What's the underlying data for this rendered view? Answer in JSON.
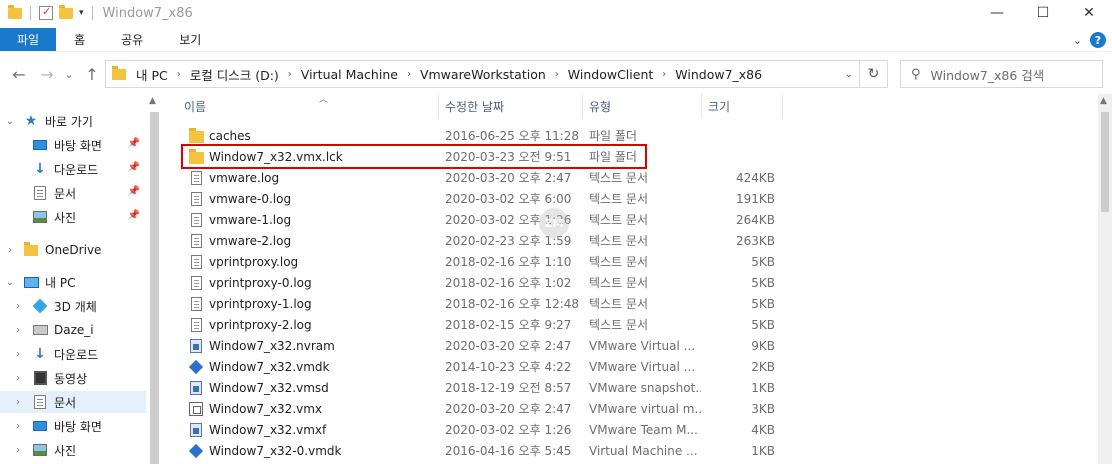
{
  "window": {
    "title": "Window7_x86",
    "controls": {
      "minimize": "—",
      "maximize": "☐",
      "close": "✕"
    }
  },
  "ribbon": {
    "tabs": [
      "파일",
      "홈",
      "공유",
      "보기"
    ],
    "help": "?"
  },
  "nav": {
    "back": "←",
    "forward": "→",
    "recent": "⌄",
    "up": "↑",
    "breadcrumb": [
      "내 PC",
      "로컬 디스크 (D:)",
      "Virtual Machine",
      "VmwareWorkstation",
      "WindowClient",
      "Window7_x86"
    ],
    "refresh": "↻",
    "search_placeholder": "Window7_x86 검색"
  },
  "sidebar": {
    "items": [
      {
        "label": "바로 가기",
        "icon": "star-icon",
        "pinned": false,
        "chevron": "⌄"
      },
      {
        "label": "바탕 화면",
        "icon": "desktop-icon",
        "pinned": true
      },
      {
        "label": "다운로드",
        "icon": "download-icon",
        "pinned": true
      },
      {
        "label": "문서",
        "icon": "document-icon",
        "pinned": true
      },
      {
        "label": "사진",
        "icon": "pictures-icon",
        "pinned": true
      },
      {
        "label": "OneDrive",
        "icon": "folder-icon",
        "chevron": "›"
      },
      {
        "label": "내 PC",
        "icon": "pc-icon",
        "chevron": "⌄"
      },
      {
        "label": "3D 개체",
        "icon": "3d-objects-icon",
        "chevron": "›"
      },
      {
        "label": "Daze_i",
        "icon": "drive-icon",
        "chevron": "›"
      },
      {
        "label": "다운로드",
        "icon": "download-icon",
        "chevron": "›"
      },
      {
        "label": "동영상",
        "icon": "video-icon",
        "chevron": "›"
      },
      {
        "label": "문서",
        "icon": "document-icon",
        "chevron": "›",
        "selected": true
      },
      {
        "label": "바탕 화면",
        "icon": "desktop-icon",
        "chevron": "›"
      },
      {
        "label": "사진",
        "icon": "pictures-icon",
        "chevron": "›"
      }
    ]
  },
  "columns": {
    "name": "이름",
    "date": "수정한 날짜",
    "type": "유형",
    "size": "크기"
  },
  "files": [
    {
      "name": "caches",
      "date": "2016-06-25 오후 11:28",
      "type": "파일 폴더",
      "size": "",
      "icon": "folder"
    },
    {
      "name": "Window7_x32.vmx.lck",
      "date": "2020-03-23 오전 9:51",
      "type": "파일 폴더",
      "size": "",
      "icon": "folder"
    },
    {
      "name": "vmware.log",
      "date": "2020-03-20 오후 2:47",
      "type": "텍스트 문서",
      "size": "424KB",
      "icon": "text"
    },
    {
      "name": "vmware-0.log",
      "date": "2020-03-02 오후 6:00",
      "type": "텍스트 문서",
      "size": "191KB",
      "icon": "text"
    },
    {
      "name": "vmware-1.log",
      "date": "2020-03-02 오후 1:26",
      "type": "텍스트 문서",
      "size": "264KB",
      "icon": "text"
    },
    {
      "name": "vmware-2.log",
      "date": "2020-02-23 오후 1:59",
      "type": "텍스트 문서",
      "size": "263KB",
      "icon": "text"
    },
    {
      "name": "vprintproxy.log",
      "date": "2018-02-16 오후 1:10",
      "type": "텍스트 문서",
      "size": "5KB",
      "icon": "text"
    },
    {
      "name": "vprintproxy-0.log",
      "date": "2018-02-16 오후 1:02",
      "type": "텍스트 문서",
      "size": "5KB",
      "icon": "text"
    },
    {
      "name": "vprintproxy-1.log",
      "date": "2018-02-16 오후 12:48",
      "type": "텍스트 문서",
      "size": "5KB",
      "icon": "text"
    },
    {
      "name": "vprintproxy-2.log",
      "date": "2018-02-15 오후 9:27",
      "type": "텍스트 문서",
      "size": "5KB",
      "icon": "text"
    },
    {
      "name": "Window7_x32.nvram",
      "date": "2020-03-20 오후 2:47",
      "type": "VMware Virtual ...",
      "size": "9KB",
      "icon": "vm"
    },
    {
      "name": "Window7_x32.vmdk",
      "date": "2014-10-23 오후 4:22",
      "type": "VMware Virtual ...",
      "size": "2KB",
      "icon": "cube"
    },
    {
      "name": "Window7_x32.vmsd",
      "date": "2018-12-19 오전 8:57",
      "type": "VMware snapshot...",
      "size": "1KB",
      "icon": "vm"
    },
    {
      "name": "Window7_x32.vmx",
      "date": "2020-03-20 오후 2:47",
      "type": "VMware virtual m...",
      "size": "3KB",
      "icon": "vmx"
    },
    {
      "name": "Window7_x32.vmxf",
      "date": "2020-03-02 오후 1:26",
      "type": "VMware Team M...",
      "size": "4KB",
      "icon": "vm"
    },
    {
      "name": "Window7_x32-0.vmdk",
      "date": "2016-04-16 오후 5:45",
      "type": "Virtual Machine ...",
      "size": "1KB",
      "icon": "cube"
    }
  ],
  "watermark": "ZM"
}
